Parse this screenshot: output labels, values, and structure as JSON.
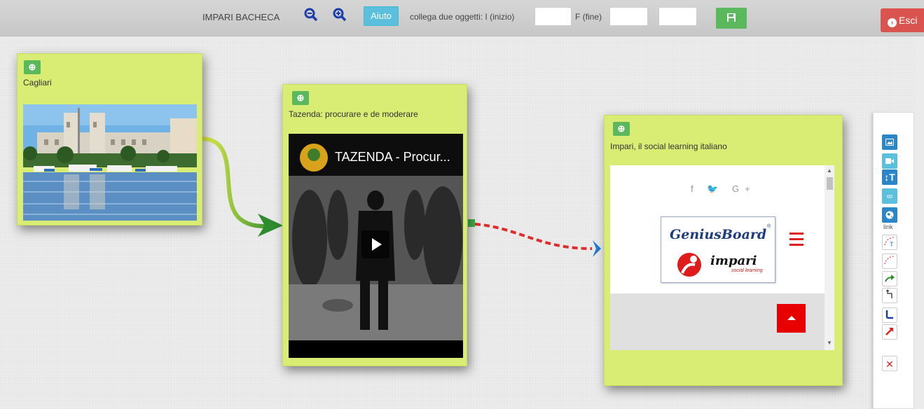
{
  "toolbar": {
    "title": "IMPARI BACHECA",
    "help_label": "Aiuto",
    "link_label": "collega due oggetti: I (inizio)",
    "end_label": "F (fine)",
    "start_value": "",
    "end_value": "",
    "extra_value": "",
    "exit_label": "Esci",
    "icons": [
      "zoom-out-icon",
      "zoom-in-icon",
      "save-icon"
    ]
  },
  "cards": [
    {
      "title": "Cagliari",
      "type": "image"
    },
    {
      "title": "Tazenda: procurare e de moderare",
      "type": "video",
      "video_title": "TAZENDA - Procur..."
    },
    {
      "title": "Impari, il social learning italiano",
      "type": "website",
      "social": "f  🐦  G+",
      "logo_top": "GeniusBoard",
      "logo_mark": "®",
      "logo_bottom": "impari",
      "logo_sub": "social learning"
    }
  ],
  "palette": {
    "link_label": "link",
    "tools": [
      "image-icon",
      "video-icon",
      "text-icon",
      "link-icon",
      "globe-icon",
      "curve-text-icon",
      "curve-dashed-icon",
      "arrow-green-icon",
      "step-icon",
      "elbow-icon",
      "arrow-red-icon",
      "delete-icon"
    ]
  },
  "colors": {
    "card": "#d9ec73",
    "accent_green": "#5cb85c",
    "help": "#5bc0de",
    "exit": "#d9534f"
  }
}
